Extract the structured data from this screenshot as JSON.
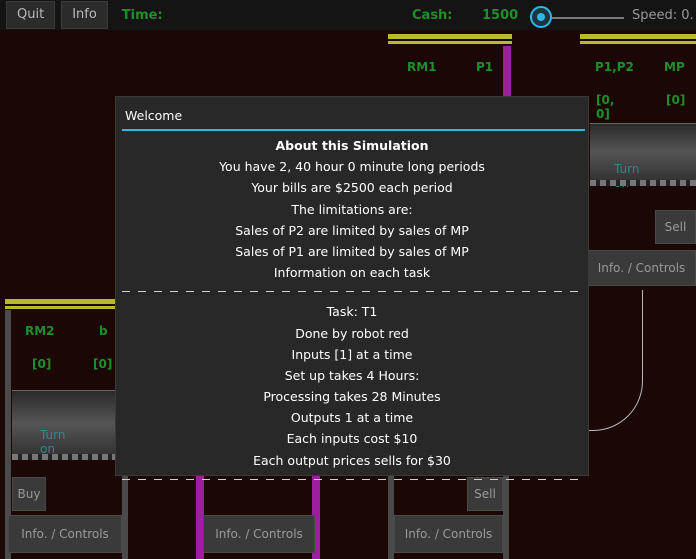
{
  "topbar": {
    "quit_label": "Quit",
    "info_label": "Info",
    "time_label": "Time:",
    "cash_label": "Cash:",
    "cash_value": "1500",
    "speed_label": "Speed: 0."
  },
  "station_top_center": {
    "labels": [
      "RM1",
      "P1"
    ]
  },
  "station_top_right": {
    "labels": [
      "P1,P2",
      "MP"
    ],
    "values": [
      "[0, 0]",
      "[0]"
    ],
    "turn_label": "Turn on",
    "sell_label": "Sell",
    "info_label": "Info. / Controls"
  },
  "station_left": {
    "labels": [
      "RM2",
      "b"
    ],
    "values": [
      "[0]",
      "[0]"
    ],
    "turn_label": "Turn on",
    "buy_label": "Buy",
    "info_label": "Info. / Controls"
  },
  "station_bottom_middle": {
    "info_label": "Info. / Controls"
  },
  "station_bottom_right": {
    "sell_label": "Sell",
    "info_label": "Info. / Controls"
  },
  "dialog": {
    "title": "Welcome",
    "lines_top": [
      "About this Simulation",
      "You have 2, 40 hour 0 minute long periods",
      "Your bills are $2500 each period",
      "The limitations are:",
      "Sales of P2 are limited by sales of MP",
      "Sales of P1 are limited by sales of MP",
      "Information on each task"
    ],
    "lines_task": [
      "Task: T1",
      "Done by robot red",
      "Inputs [1] at a time",
      "Set up takes  4 Hours:",
      "Processing takes 28 Minutes",
      "Outputs 1 at a time",
      "Each inputs cost $10",
      "Each output prices sells for $30"
    ]
  },
  "colors": {
    "accent": "#33b5e5",
    "label_green": "#1f8f2a",
    "station_yellow": "#b7b92e",
    "background": "#1c0707"
  }
}
